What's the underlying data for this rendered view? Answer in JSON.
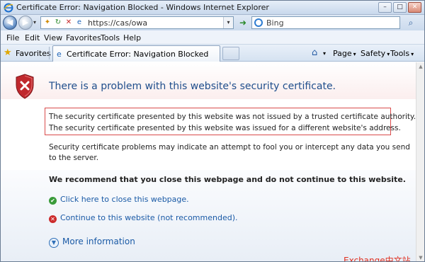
{
  "window": {
    "title": "Certificate Error: Navigation Blocked - Windows Internet Explorer",
    "minimize_glyph": "–",
    "maximize_glyph": "□",
    "close_glyph": "✕"
  },
  "address_bar": {
    "url": "https://cas/owa",
    "dropdown_glyph": "▾",
    "go_glyph": "➜",
    "stop_glyph": "✕"
  },
  "search": {
    "placeholder": "Bing",
    "button_glyph": "⌕"
  },
  "menu": [
    "File",
    "Edit",
    "View",
    "Favorites",
    "Tools",
    "Help"
  ],
  "favorites_bar": {
    "favorites_label": "Favorites",
    "tab_label": "Certificate Error: Navigation Blocked",
    "commands": {
      "page": "Page",
      "safety": "Safety",
      "tools": "Tools"
    }
  },
  "page": {
    "heading": "There is a problem with this website's security certificate.",
    "errors": [
      "The security certificate presented by this website was not issued by a trusted certificate authority.",
      "The security certificate presented by this website was issued for a different website's address."
    ],
    "warning": "Security certificate problems may indicate an attempt to fool you or intercept any data you send to the server.",
    "recommendation": "We recommend that you close this webpage and do not continue to this website.",
    "close_link": "Click here to close this webpage.",
    "continue_link": "Continue to this website (not recommended).",
    "more_info": "More information"
  },
  "watermark": "Exchange中文站",
  "colors": {
    "heading": "#1f4e8c",
    "link": "#1a5aa6",
    "error_border": "#d94b4b",
    "shield_red": "#c0282d",
    "watermark": "#e03020"
  }
}
